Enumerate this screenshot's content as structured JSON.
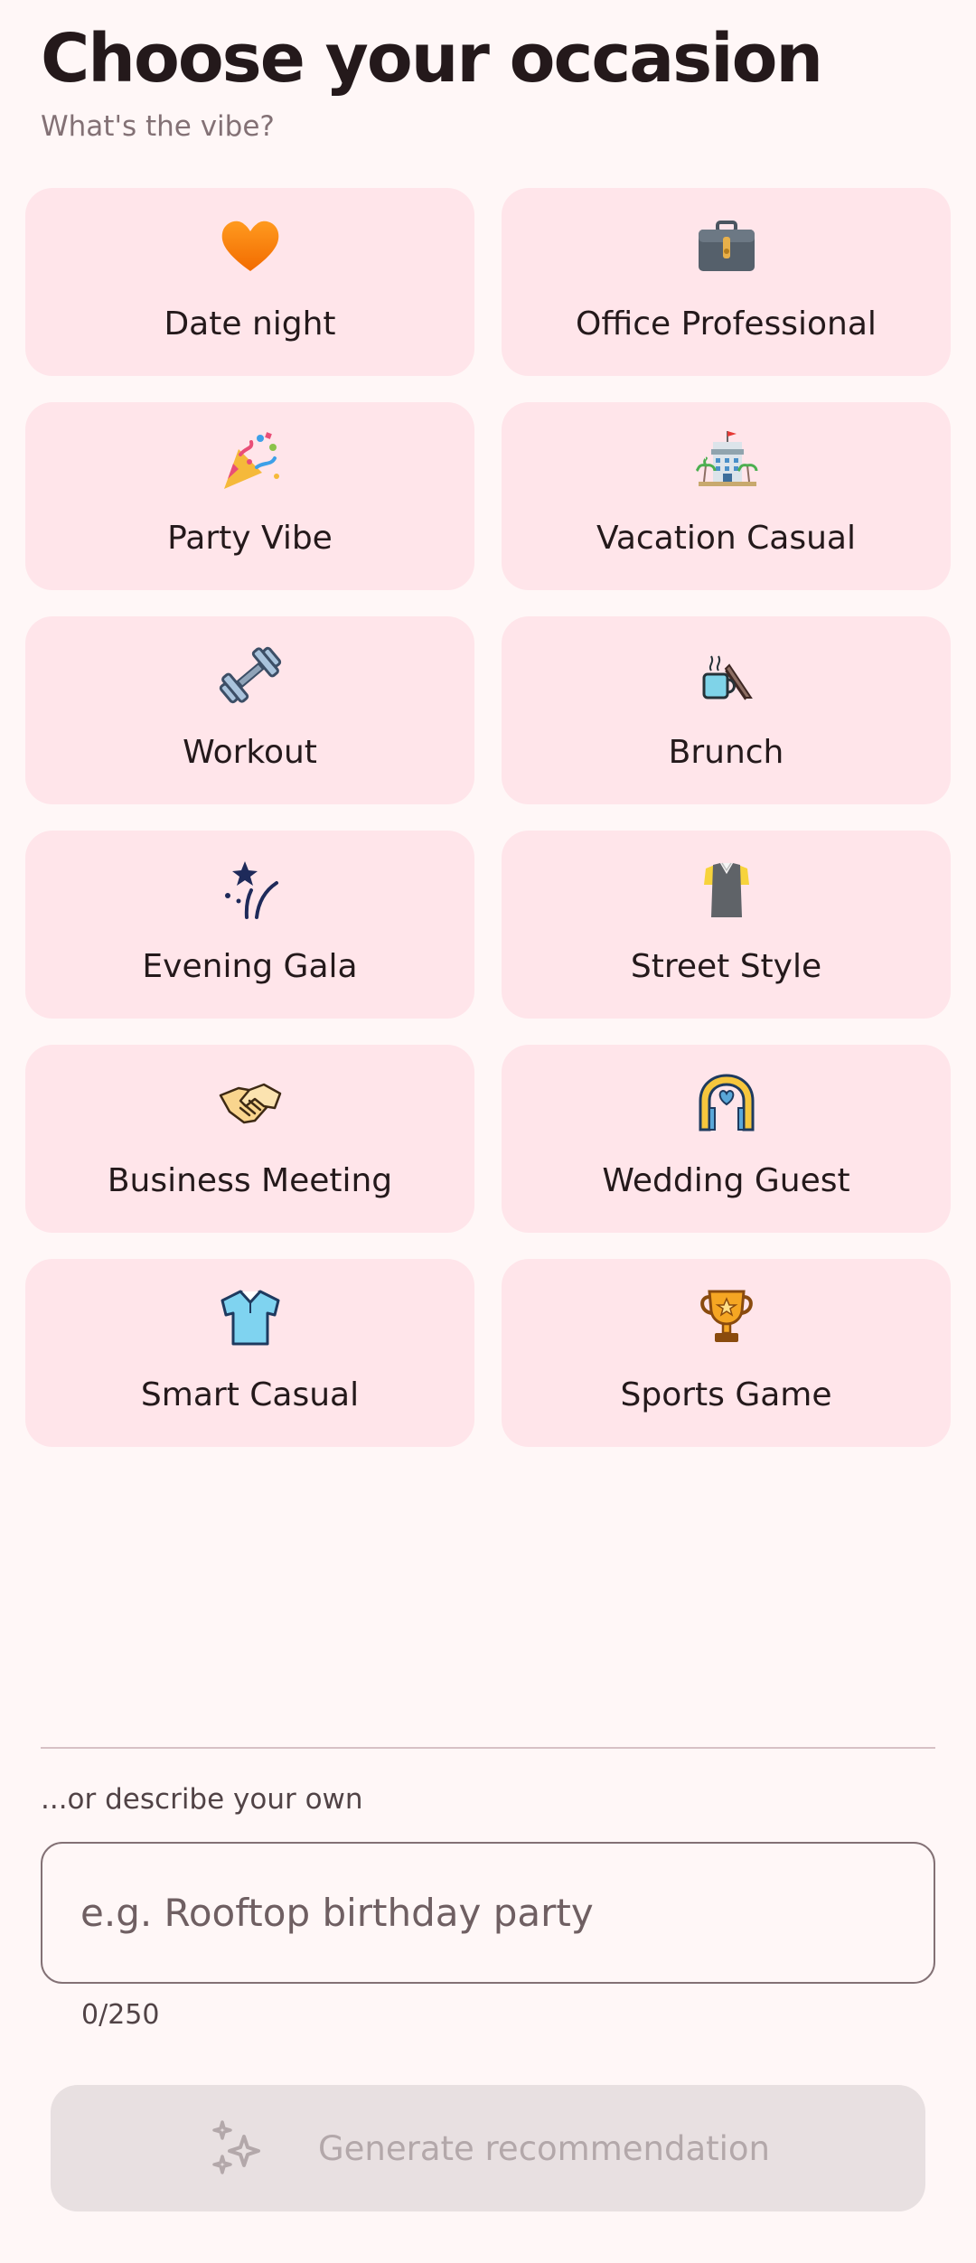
{
  "header": {
    "title": "Choose your occasion",
    "subtitle": "What's the vibe?"
  },
  "occasions": [
    {
      "label": "Date night",
      "icon": "orange-heart-icon"
    },
    {
      "label": "Office Professional",
      "icon": "briefcase-icon"
    },
    {
      "label": "Party Vibe",
      "icon": "party-popper-icon"
    },
    {
      "label": "Vacation Casual",
      "icon": "hotel-icon"
    },
    {
      "label": "Workout",
      "icon": "dumbbell-icon"
    },
    {
      "label": "Brunch",
      "icon": "hot-beverage-icon"
    },
    {
      "label": "Evening Gala",
      "icon": "firework-sparkler-icon"
    },
    {
      "label": "Street Style",
      "icon": "vest-shirt-icon"
    },
    {
      "label": "Business Meeting",
      "icon": "handshake-icon"
    },
    {
      "label": "Wedding Guest",
      "icon": "wedding-arch-icon"
    },
    {
      "label": "Smart Casual",
      "icon": "polo-shirt-icon"
    },
    {
      "label": "Sports Game",
      "icon": "trophy-icon"
    }
  ],
  "custom": {
    "label": "...or describe your own",
    "placeholder": "e.g. Rooftop birthday party",
    "value": "",
    "counter": "0/250"
  },
  "generate": {
    "label": "Generate recommendation",
    "icon": "sparkles-icon",
    "disabled": true
  },
  "colors": {
    "background": "#FFF7F7",
    "card": "#FFE5EA",
    "text": "#24191B",
    "muted": "#837175",
    "button_disabled_bg": "#E8E0E1",
    "button_disabled_text": "#B3A8AA"
  }
}
